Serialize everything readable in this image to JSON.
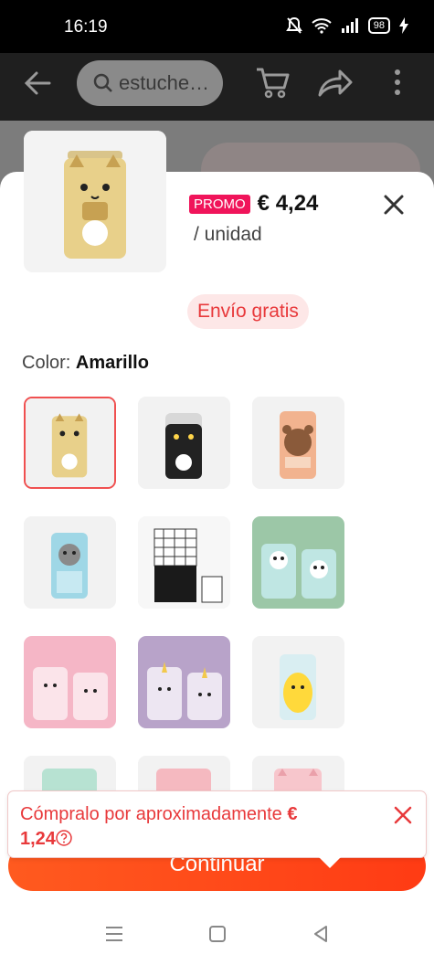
{
  "status_bar": {
    "time": "16:19",
    "battery": "98"
  },
  "header": {
    "search_text": "estuche…"
  },
  "product": {
    "promo_badge": "PROMO",
    "price": "€ 4,24",
    "unit": "/ unidad",
    "shipping": "Envío gratis"
  },
  "color": {
    "label": "Color:",
    "value": "Amarillo"
  },
  "toast": {
    "text": "Cómpralo por aproximadamente",
    "amount_part1": "€",
    "amount_part2": "1,24"
  },
  "continue_button": {
    "label": "Continuar"
  },
  "colors": {
    "accent": "#e8393b",
    "promo": "#f0145a",
    "cta": "#ff4a1a"
  },
  "swatches": [
    {
      "name": "yellow-cat",
      "selected": true
    },
    {
      "name": "black-cat",
      "selected": false
    },
    {
      "name": "bear",
      "selected": false
    },
    {
      "name": "blue-cat",
      "selected": false
    },
    {
      "name": "grid",
      "selected": false
    },
    {
      "name": "green-panda",
      "selected": false
    },
    {
      "name": "pink-cat",
      "selected": false
    },
    {
      "name": "purple-unicorn",
      "selected": false
    },
    {
      "name": "yellow-chick",
      "selected": false
    },
    {
      "name": "mint",
      "selected": false
    },
    {
      "name": "pink",
      "selected": false
    },
    {
      "name": "pink-cat-2",
      "selected": false
    }
  ]
}
